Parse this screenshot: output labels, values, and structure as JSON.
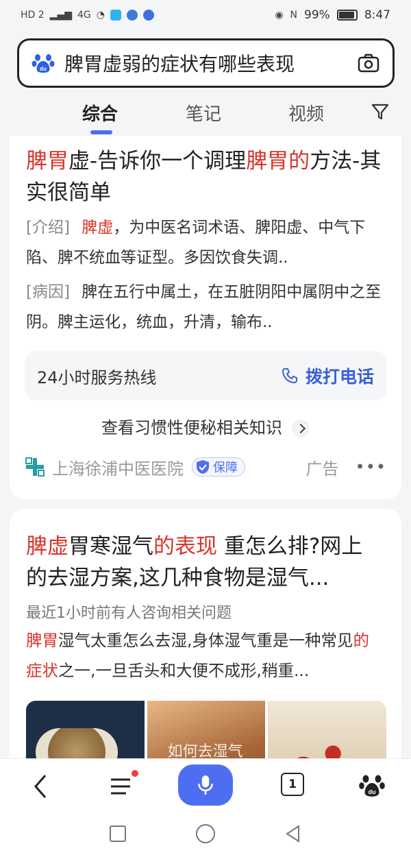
{
  "status_bar": {
    "network_label": "HD 2",
    "signal_label": "4G",
    "battery": "99%",
    "time": "8:47"
  },
  "search": {
    "query": "脾胃虚弱的症状有哪些表现",
    "logo_icon": "baidu-paw-icon",
    "camera_icon": "camera-icon"
  },
  "tabs": [
    {
      "label": "综合",
      "active": true
    },
    {
      "label": "笔记",
      "active": false
    },
    {
      "label": "视频",
      "active": false
    }
  ],
  "filter_icon": "filter-icon",
  "result1": {
    "title_parts": [
      {
        "text": "脾胃",
        "highlight": true
      },
      {
        "text": "虚-告诉你一个调理",
        "highlight": false
      },
      {
        "text": "脾胃的",
        "highlight": true
      },
      {
        "text": "方法-其实很简单",
        "highlight": false
      }
    ],
    "intro_tag": "[介绍]",
    "intro_highlight": "脾虚",
    "intro_text": "，为中医名词术语、脾阳虚、中气下陷、脾不统血等证型。多因饮食失调..",
    "cause_tag": "[病因]",
    "cause_text": "脾在五行中属土，在五脏阴阳中属阴中之至阴。脾主运化，统血，升清，输布..",
    "hotline_label": "24小时服务热线",
    "call_label": "拨打电话",
    "more_link": "查看习惯性便秘相关知识",
    "source_name": "上海徐浦中医医院",
    "guarantee_label": "保障",
    "ad_label": "广告",
    "more_icon": "more-dots-icon"
  },
  "result2": {
    "title_parts": [
      {
        "text": "脾虚",
        "highlight": true
      },
      {
        "text": "胃寒湿气",
        "highlight": false
      },
      {
        "text": "的表现",
        "highlight": true
      },
      {
        "text": " 重怎么排?网上的去湿方案,这几种食物是湿气...",
        "highlight": false
      }
    ],
    "meta": "最近1小时前有人咨询相关问题",
    "snippet_parts": [
      {
        "text": "脾胃",
        "highlight": true
      },
      {
        "text": "湿气太重怎么去湿,身体湿气重是一种常见",
        "highlight": false
      },
      {
        "text": "的症状",
        "highlight": true
      },
      {
        "text": "之一,一旦舌头和大便不成形,稍重...",
        "highlight": false
      }
    ],
    "thumb2_text": "如何去湿气"
  },
  "toolbar": {
    "tab_count": "1"
  },
  "colors": {
    "accent": "#4e6ef2",
    "highlight": "#d9342b"
  }
}
